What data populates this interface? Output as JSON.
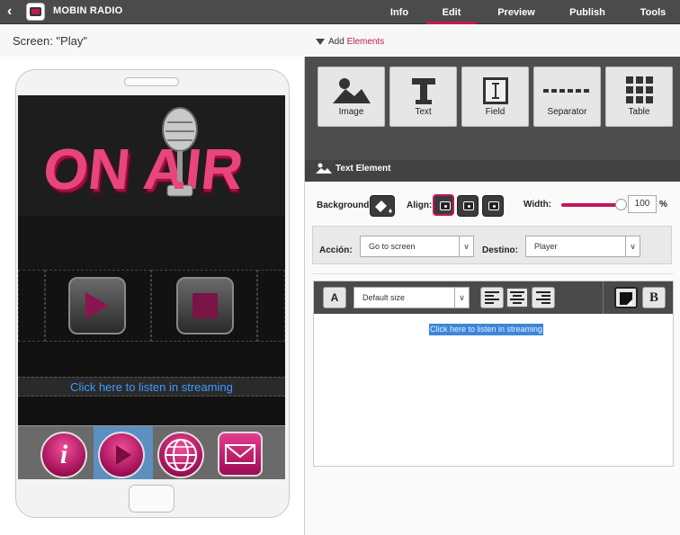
{
  "topbar": {
    "title": "MOBIN RADIO",
    "tabs": [
      {
        "label": "Info"
      },
      {
        "label": "Edit"
      },
      {
        "label": "Preview"
      },
      {
        "label": "Publish"
      },
      {
        "label": "Tools"
      }
    ],
    "active_tab": "Edit",
    "accent_color": "#c2185b"
  },
  "subbar": {
    "screen_label": "Screen: \"Play\"",
    "add_prefix": "Add",
    "add_link": "Elements"
  },
  "phone": {
    "banner_text": "ON AIR",
    "stream_link": "Click here to listen in streaming",
    "nav_icons": [
      "info-icon",
      "play-icon",
      "globe-icon",
      "mail-icon"
    ],
    "selected_nav": "play-icon"
  },
  "palette": {
    "items": [
      {
        "label": "Image",
        "icon": "image-icon"
      },
      {
        "label": "Text",
        "icon": "text-icon"
      },
      {
        "label": "Field",
        "icon": "field-icon"
      },
      {
        "label": "Separator",
        "icon": "separator-icon"
      },
      {
        "label": "Table",
        "icon": "table-icon"
      }
    ]
  },
  "section": {
    "title": "Text Element"
  },
  "props": {
    "background_label": "Background:",
    "align_label": "Align:",
    "width_label": "Width:",
    "width_value": "100",
    "width_unit": "%",
    "width_level": 1.0
  },
  "action": {
    "accion_label": "Acción:",
    "accion_value": "Go to screen",
    "destino_label": "Destino:",
    "destino_value": "Player"
  },
  "editor": {
    "size_value": "Default size",
    "bold_label": "B",
    "font_label": "A",
    "content": "Click here to listen in streaming"
  }
}
